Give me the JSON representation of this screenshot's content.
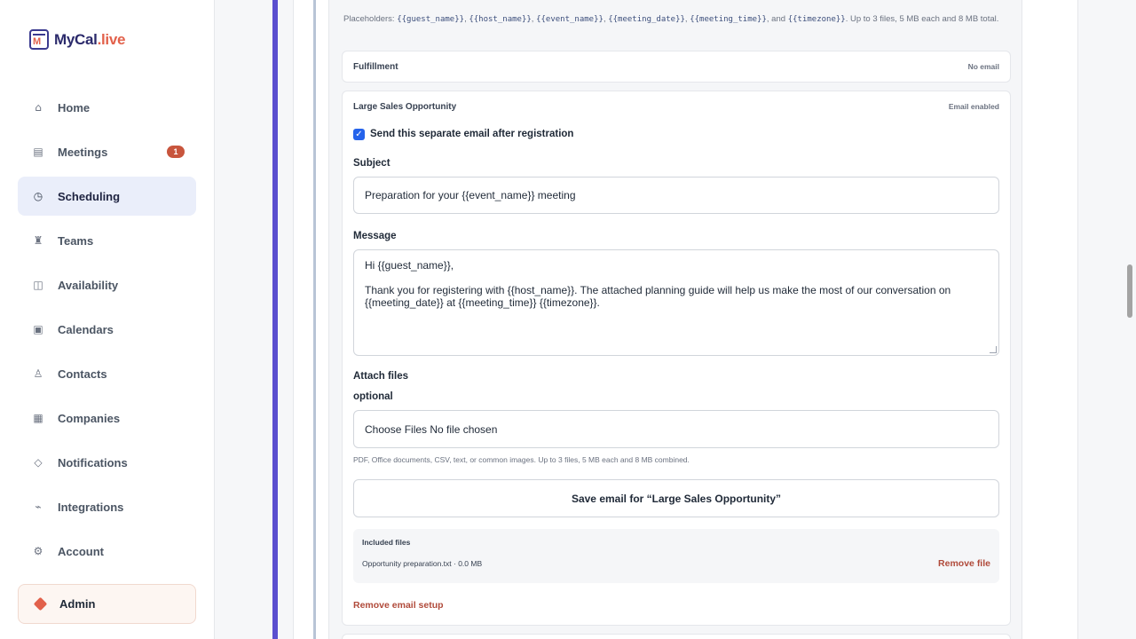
{
  "brand": {
    "name_main": "MyCal",
    "name_suffix": ".live",
    "icon_letter": "M"
  },
  "sidebar": {
    "items": [
      {
        "label": "Home",
        "icon": "home-icon",
        "glyph": "⌂"
      },
      {
        "label": "Meetings",
        "icon": "meetings-icon",
        "glyph": "▤",
        "badge": "1"
      },
      {
        "label": "Scheduling",
        "icon": "clock-icon",
        "glyph": "◷",
        "active": true
      },
      {
        "label": "Teams",
        "icon": "teams-icon",
        "glyph": "♜"
      },
      {
        "label": "Availability",
        "icon": "availability-icon",
        "glyph": "◫"
      },
      {
        "label": "Calendars",
        "icon": "calendar-icon",
        "glyph": "▣"
      },
      {
        "label": "Contacts",
        "icon": "contacts-icon",
        "glyph": "♙"
      },
      {
        "label": "Companies",
        "icon": "companies-icon",
        "glyph": "▦"
      },
      {
        "label": "Notifications",
        "icon": "notifications-icon",
        "glyph": "◇"
      },
      {
        "label": "Integrations",
        "icon": "integrations-icon",
        "glyph": "⌁"
      },
      {
        "label": "Account",
        "icon": "account-icon",
        "glyph": "⚙"
      }
    ],
    "admin_label": "Admin"
  },
  "placeholders": {
    "prefix": "Placeholders: ",
    "tokens": [
      "{{guest_name}}",
      "{{host_name}}",
      "{{event_name}}",
      "{{meeting_date}}",
      "{{meeting_time}}",
      "{{timezone}}"
    ],
    "suffix": ". Up to 3 files, 5 MB each and 8 MB total."
  },
  "fulfillment": {
    "title": "Fulfillment",
    "status": "No email"
  },
  "email_card": {
    "title": "Large Sales Opportunity",
    "status": "Email enabled",
    "checkbox_label": "Send this separate email after registration",
    "checkbox_checked": true,
    "subject_label": "Subject",
    "subject_value": "Preparation for your {{event_name}} meeting",
    "message_label": "Message",
    "message_value": "Hi {{guest_name}},\n\nThank you for registering with {{host_name}}. The attached planning guide will help us make the most of our conversation on {{meeting_date}} at {{meeting_time}} {{timezone}}.",
    "attach_label": "Attach files",
    "attach_optional": "optional",
    "file_input_text": "Choose Files No file chosen",
    "file_hint": "PDF, Office documents, CSV, text, or common images. Up to 3 files, 5 MB each and 8 MB combined.",
    "save_button": "Save email for “Large Sales Opportunity”",
    "included_heading": "Included files",
    "included_file": "Opportunity preparation.txt · 0.0 MB",
    "remove_file": "Remove file",
    "remove_setup": "Remove email setup"
  },
  "colors": {
    "accent": "#5b4fcf",
    "brand_orange": "#e2614b",
    "danger_text": "#b04a3a",
    "checkbox": "#2563eb"
  }
}
